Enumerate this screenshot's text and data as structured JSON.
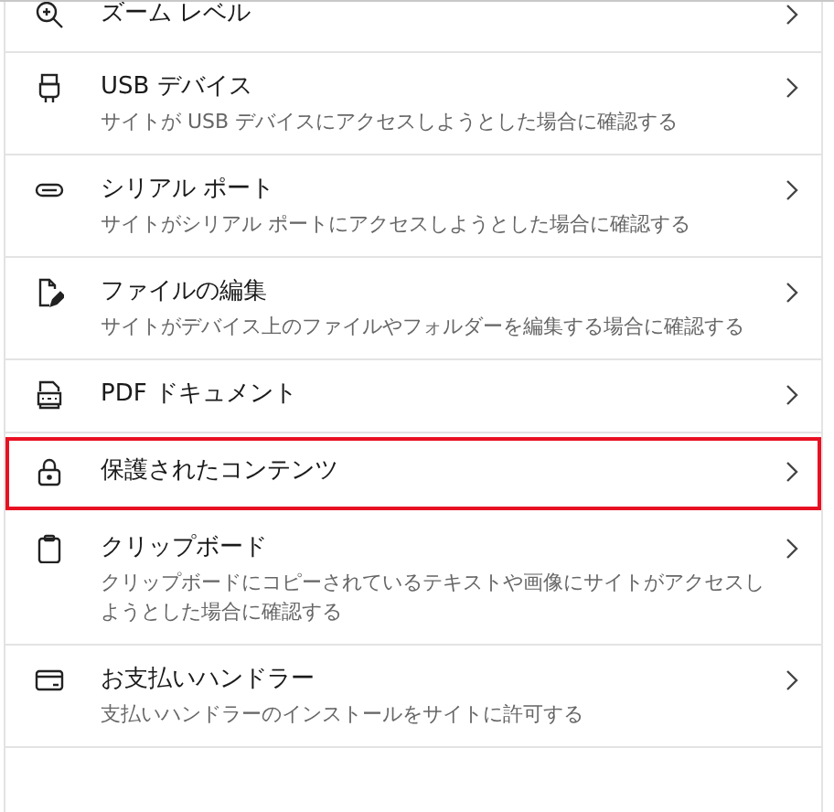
{
  "settings_list": [
    {
      "title": "ズーム レベル",
      "highlighted": false
    },
    {
      "title": "USB デバイス",
      "description": "サイトが USB デバイスにアクセスしようとした場合に確認する",
      "highlighted": false
    },
    {
      "title": "シリアル ポート",
      "description": "サイトがシリアル ポートにアクセスしようとした場合に確認する",
      "highlighted": false
    },
    {
      "title": "ファイルの編集",
      "description": "サイトがデバイス上のファイルやフォルダーを編集する場合に確認する",
      "highlighted": false
    },
    {
      "title": "PDF ドキュメント",
      "highlighted": false
    },
    {
      "title": "保護されたコンテンツ",
      "highlighted": true
    },
    {
      "title": "クリップボード",
      "description": "クリップボードにコピーされているテキストや画像にサイトがアクセスしようとした場合に確認する",
      "highlighted": false
    },
    {
      "title": "お支払いハンドラー",
      "description": "支払いハンドラーのインストールをサイトに許可する",
      "highlighted": false
    }
  ]
}
